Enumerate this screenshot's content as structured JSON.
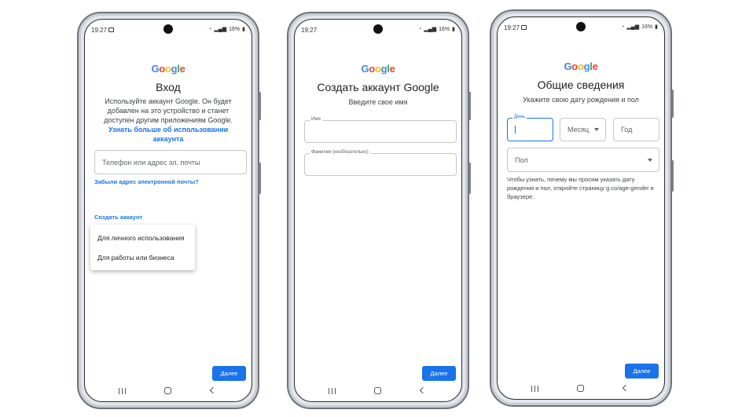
{
  "status": {
    "time": "19:27",
    "battery": "16%"
  },
  "google_logo": [
    "G",
    "o",
    "o",
    "g",
    "l",
    "e"
  ],
  "screen1": {
    "title": "Вход",
    "description": "Используйте аккаунт Google. Он будет добавлен на это устройство и станет доступен другим приложениям Google.",
    "learn_more": "Узнать больше об использовании аккаунта",
    "phone_placeholder": "Телефон или адрес эл. почты",
    "forgot_email": "Забыли адрес электронной почты?",
    "create_account": "Создать аккаунт",
    "menu": [
      "Для личного использования",
      "Для работы или бизнеса"
    ],
    "next": "Далее"
  },
  "screen2": {
    "title": "Создать аккаунт Google",
    "subtitle": "Введите свое имя",
    "first_name_label": "Имя",
    "last_name_label": "Фамилия (необязательно)",
    "next": "Далее"
  },
  "screen3": {
    "title": "Общие сведения",
    "subtitle": "Укажите свою дату рождения и пол",
    "day_label": "День",
    "month_placeholder": "Месяц",
    "year_placeholder": "Год",
    "gender_placeholder": "Пол",
    "hint": "Чтобы узнать, почему мы просим указать дату рождения и пол, откройте страницу g.co/age-gender в браузере.",
    "next": "Далее"
  }
}
